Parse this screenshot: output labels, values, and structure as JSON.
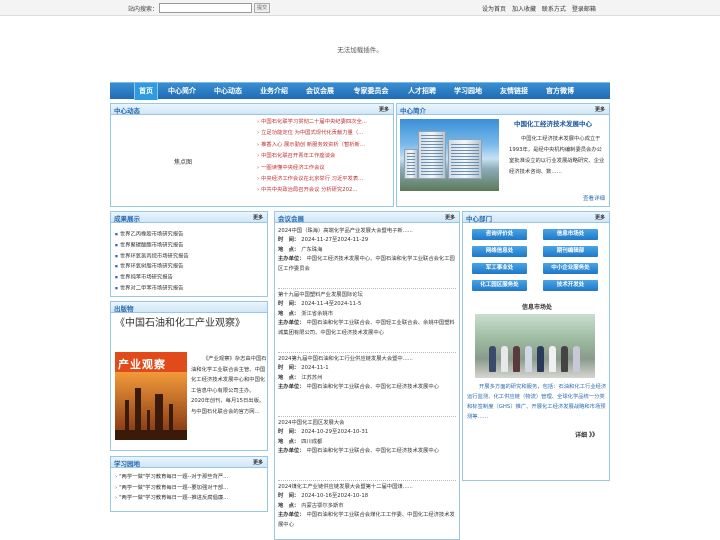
{
  "topbar": {
    "search_label": "站内搜索：",
    "search_value": "",
    "search_button": "提交",
    "links": [
      "设为首页",
      "加入收藏",
      "联系方式",
      "登录邮箱"
    ]
  },
  "plugin_notice": "无法加载插件。",
  "nav": [
    "首页",
    "中心简介",
    "中心动态",
    "业务介绍",
    "会议会展",
    "专家委员会",
    "人才招聘",
    "学习园地",
    "友情链接",
    "官方微博"
  ],
  "news": {
    "title": "中心动态",
    "more": "更多",
    "focus_label": "焦点图",
    "items": [
      "中国石化联学习贯彻二十届中央纪委四次全...",
      "立足功能定位 为中国式现代化贡献力量（...",
      "推香入心 展示勤创 新服务效资析（暂析新...",
      "中国石化联召开青年工作座谈会",
      "一图读懂中央经济工作会议",
      "中央经济工作会议在北京举行 习近平发表...",
      "中共中央政治局召开会议 分析研究202..."
    ]
  },
  "intro": {
    "title": "中心简介",
    "more": "更多",
    "heading": "中国化工经济技术发展中心",
    "text": "中国化工经济技术发展中心成立于1993年，是经中央机构编制委员会办公室批准设立的以行业发展战略研究、企业经济技术咨询、数……",
    "detail": "查看详细"
  },
  "achievements": {
    "title": "成果展示",
    "more": "更多",
    "items": [
      "世界乙丙橡胶市场研究报告",
      "世界聚碳酸酯市场研究报告",
      "世界环氧氯丙烷市场研究报告",
      "世界环氧树脂市场研究报告",
      "世界纯苯市场研究报告",
      "世界对二甲苯市场研究报告"
    ]
  },
  "publication": {
    "title": "出版物",
    "name": "《中国石油和化工产业观察》",
    "cover_title": "产业观察",
    "text": "《产业观察》杂志由中国石油和化学工业联合会主管、中国化工经济技术发展中心和中国化工信息中心有限公司主办。2020年创刊，每月15日出版。与中国石化联合会的官方网..."
  },
  "study": {
    "title": "学习园地",
    "more": "更多",
    "items": [
      "\"两学一做\"学习教育每日一题--对于那些背严...",
      "\"两学一做\"学习教育每日一题--要加强对干部...",
      "\"两学一做\"学习教育每日一题--推进反腐倡廉..."
    ]
  },
  "meetings": {
    "title": "会议会展",
    "more": "更多",
    "labels": {
      "time": "时　间：",
      "place": "地　点：",
      "host": "主办单位："
    },
    "items": [
      {
        "title": "2024中国（珠海）高端化学品产业发展大会暨电子新......",
        "time": "2024-11-27至2024-11-29",
        "place": "广东珠海",
        "host": "中国化工经济技术发展中心、中国石油和化学工业联合会化工园区工作委员会"
      },
      {
        "title": "第十九届中国塑料产业发展国际论坛",
        "time": "2024-11-4至2024-11-5",
        "place": "浙江省余姚市",
        "host": "中国石油和化学工业联合会、中国轻工业联合会、余姚中国塑料城集团有限公司、中国化工经济技术发展中心"
      },
      {
        "title": "2024第九届中国石油和化工行业供应链发展大会暨中......",
        "time": "2024-11-1",
        "place": "江苏苏州",
        "host": "中国石油和化学工业联合会、中国化工经济技术发展中心"
      },
      {
        "title": "2024中国化工园区发展大会",
        "time": "2024-10-29至2024-10-31",
        "place": "四川成都",
        "host": "中国石油和化学工业联合会、中国化工经济技术发展中心"
      },
      {
        "title": "2024煤化工产业链供应链发展大会暨第十二届中国煤......",
        "time": "2024-10-16至2024-10-18",
        "place": "内蒙古鄂尔多斯市",
        "host": "中国石油和化学工业联合会煤化工工作委、中国化工经济技术发展中心"
      }
    ]
  },
  "departments": {
    "title": "中心部门",
    "more": "更多",
    "items": [
      "咨询评价处",
      "信息市场处",
      "网络信息处",
      "期刊编辑部",
      "军工事业处",
      "中小企业服务处",
      "化工园区服务处",
      "技术开发处"
    ],
    "info_title": "信息市场处",
    "info_text": "开展多方面的研究和服务，包括：石油和化工行业经济运行监测、化工供应链（物流）管理、全球化学品统一分类和标签制度（GHS）推广、开展化工经济发展战略和市场预测等……",
    "info_more": "详细 》》"
  }
}
